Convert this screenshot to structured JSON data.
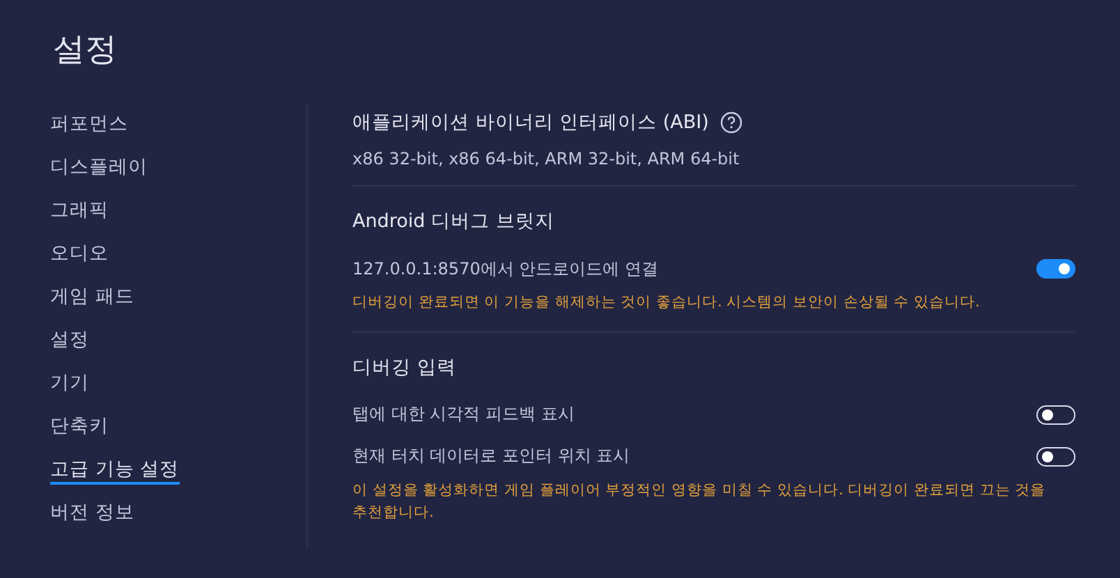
{
  "title": "설정",
  "sidebar": {
    "items": [
      {
        "label": "퍼포먼스",
        "selected": false
      },
      {
        "label": "디스플레이",
        "selected": false
      },
      {
        "label": "그래픽",
        "selected": false
      },
      {
        "label": "오디오",
        "selected": false
      },
      {
        "label": "게임 패드",
        "selected": false
      },
      {
        "label": "설정",
        "selected": false
      },
      {
        "label": "기기",
        "selected": false
      },
      {
        "label": "단축키",
        "selected": false
      },
      {
        "label": "고급 기능 설정",
        "selected": true
      },
      {
        "label": "버전 정보",
        "selected": false
      }
    ]
  },
  "sections": [
    {
      "title": "애플리케이션 바이너리 인터페이스 (ABI)",
      "help": true,
      "items": [
        {
          "kind": "text",
          "text": "x86 32-bit, x86 64-bit, ARM 32-bit, ARM 64-bit"
        }
      ]
    },
    {
      "title": "Android 디버그 브릿지",
      "help": false,
      "items": [
        {
          "kind": "toggle",
          "label": "127.0.0.1:8570에서 안드로이드에 연결",
          "on": true
        },
        {
          "kind": "warning",
          "text": "디버깅이 완료되면 이 기능을 해제하는 것이 좋습니다. 시스템의 보안이 손상될 수 있습니다."
        }
      ]
    },
    {
      "title": "디버깅 입력",
      "help": false,
      "items": [
        {
          "kind": "toggle",
          "label": "탭에 대한 시각적 피드백 표시",
          "on": false
        },
        {
          "kind": "toggle",
          "label": "현재 터치 데이터로 포인터 위치 표시",
          "on": false
        },
        {
          "kind": "warning",
          "text": "이 설정을 활성화하면 게임 플레이어 부정적인 영향을 미칠 수 있습니다. 디버깅이 완료되면 끄는 것을 추천합니다."
        }
      ]
    }
  ]
}
